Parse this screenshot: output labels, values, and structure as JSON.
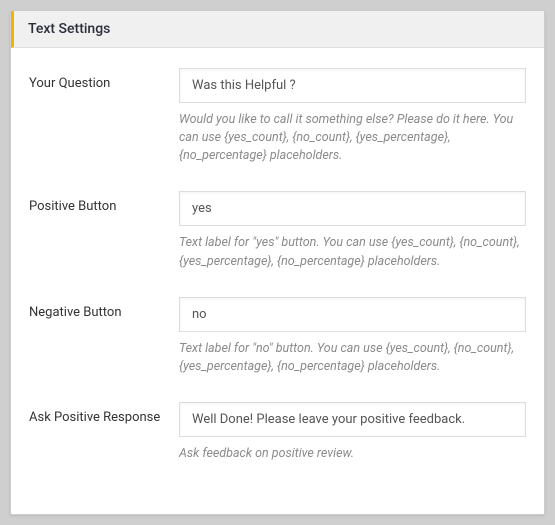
{
  "panel": {
    "title": "Text Settings"
  },
  "fields": {
    "question": {
      "label": "Your Question",
      "value": "Was this Helpful ?",
      "help": "Would you like to call it something else? Please do it here. You can use {yes_count}, {no_count}, {yes_percentage}, {no_percentage} placeholders."
    },
    "positive_button": {
      "label": "Positive Button",
      "value": "yes",
      "help": "Text label for \"yes\" button. You can use {yes_count}, {no_count}, {yes_percentage}, {no_percentage} placeholders."
    },
    "negative_button": {
      "label": "Negative Button",
      "value": "no",
      "help": "Text label for \"no\" button. You can use {yes_count}, {no_count}, {yes_percentage}, {no_percentage} placeholders."
    },
    "ask_positive_response": {
      "label": "Ask Positive Response",
      "value": "Well Done! Please leave your positive feedback.",
      "help": "Ask feedback on positive review."
    }
  }
}
